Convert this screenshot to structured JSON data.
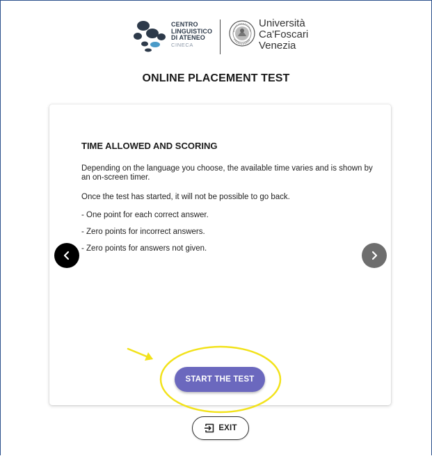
{
  "header": {
    "cla_logo": {
      "line1": "CENTRO",
      "line2": "LINGUISTICO",
      "line3": "DI ATENEO",
      "line4": "CINECA"
    },
    "university_logo": {
      "line1": "Università",
      "line2": "Ca'Foscari",
      "line3": "Venezia"
    },
    "page_title": "ONLINE PLACEMENT TEST"
  },
  "card": {
    "section_title": "TIME ALLOWED AND SCORING",
    "paragraphs": [
      "Depending on the language you choose, the available time varies and is shown by an on-screen timer.",
      "Once the test has started, it will not be possible to go back.",
      "- One point for each correct answer.",
      "- Zero points for incorrect answers.",
      "- Zero points for answers not given."
    ],
    "start_button_label": "START THE TEST"
  },
  "navigation": {
    "prev_icon": "chevron-left-icon",
    "next_icon": "chevron-right-icon"
  },
  "exit_button": {
    "label": "EXIT",
    "icon": "exit-icon"
  },
  "colors": {
    "start_button": "#6b68be",
    "annotation_highlight": "#f2e21a",
    "frame_border": "#2b4f8c",
    "prev_button": "#000000",
    "next_button": "#6e6e6e"
  }
}
